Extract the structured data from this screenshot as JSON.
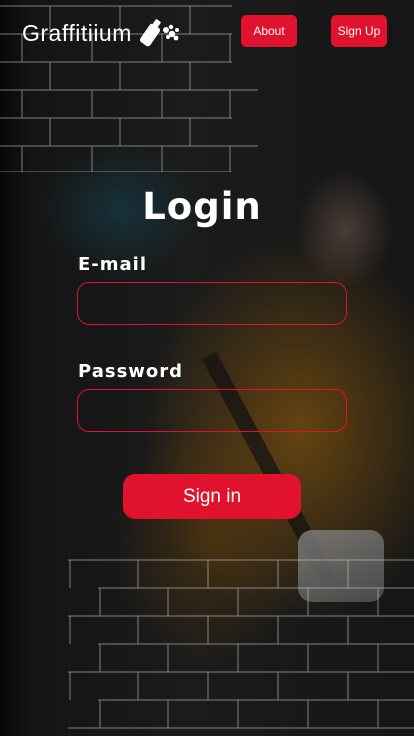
{
  "app": {
    "logo_text": "Graffitiium"
  },
  "nav": {
    "about_label": "About",
    "signup_label": "Sign Up"
  },
  "login": {
    "title": "Login",
    "email_label": "E-mail",
    "email_value": "",
    "password_label": "Password",
    "password_value": "",
    "submit_label": "Sign in"
  },
  "colors": {
    "accent": "#e0122e",
    "text": "#ffffff",
    "background": "#141414"
  },
  "icons": {
    "logo": "spray-can-icon"
  }
}
